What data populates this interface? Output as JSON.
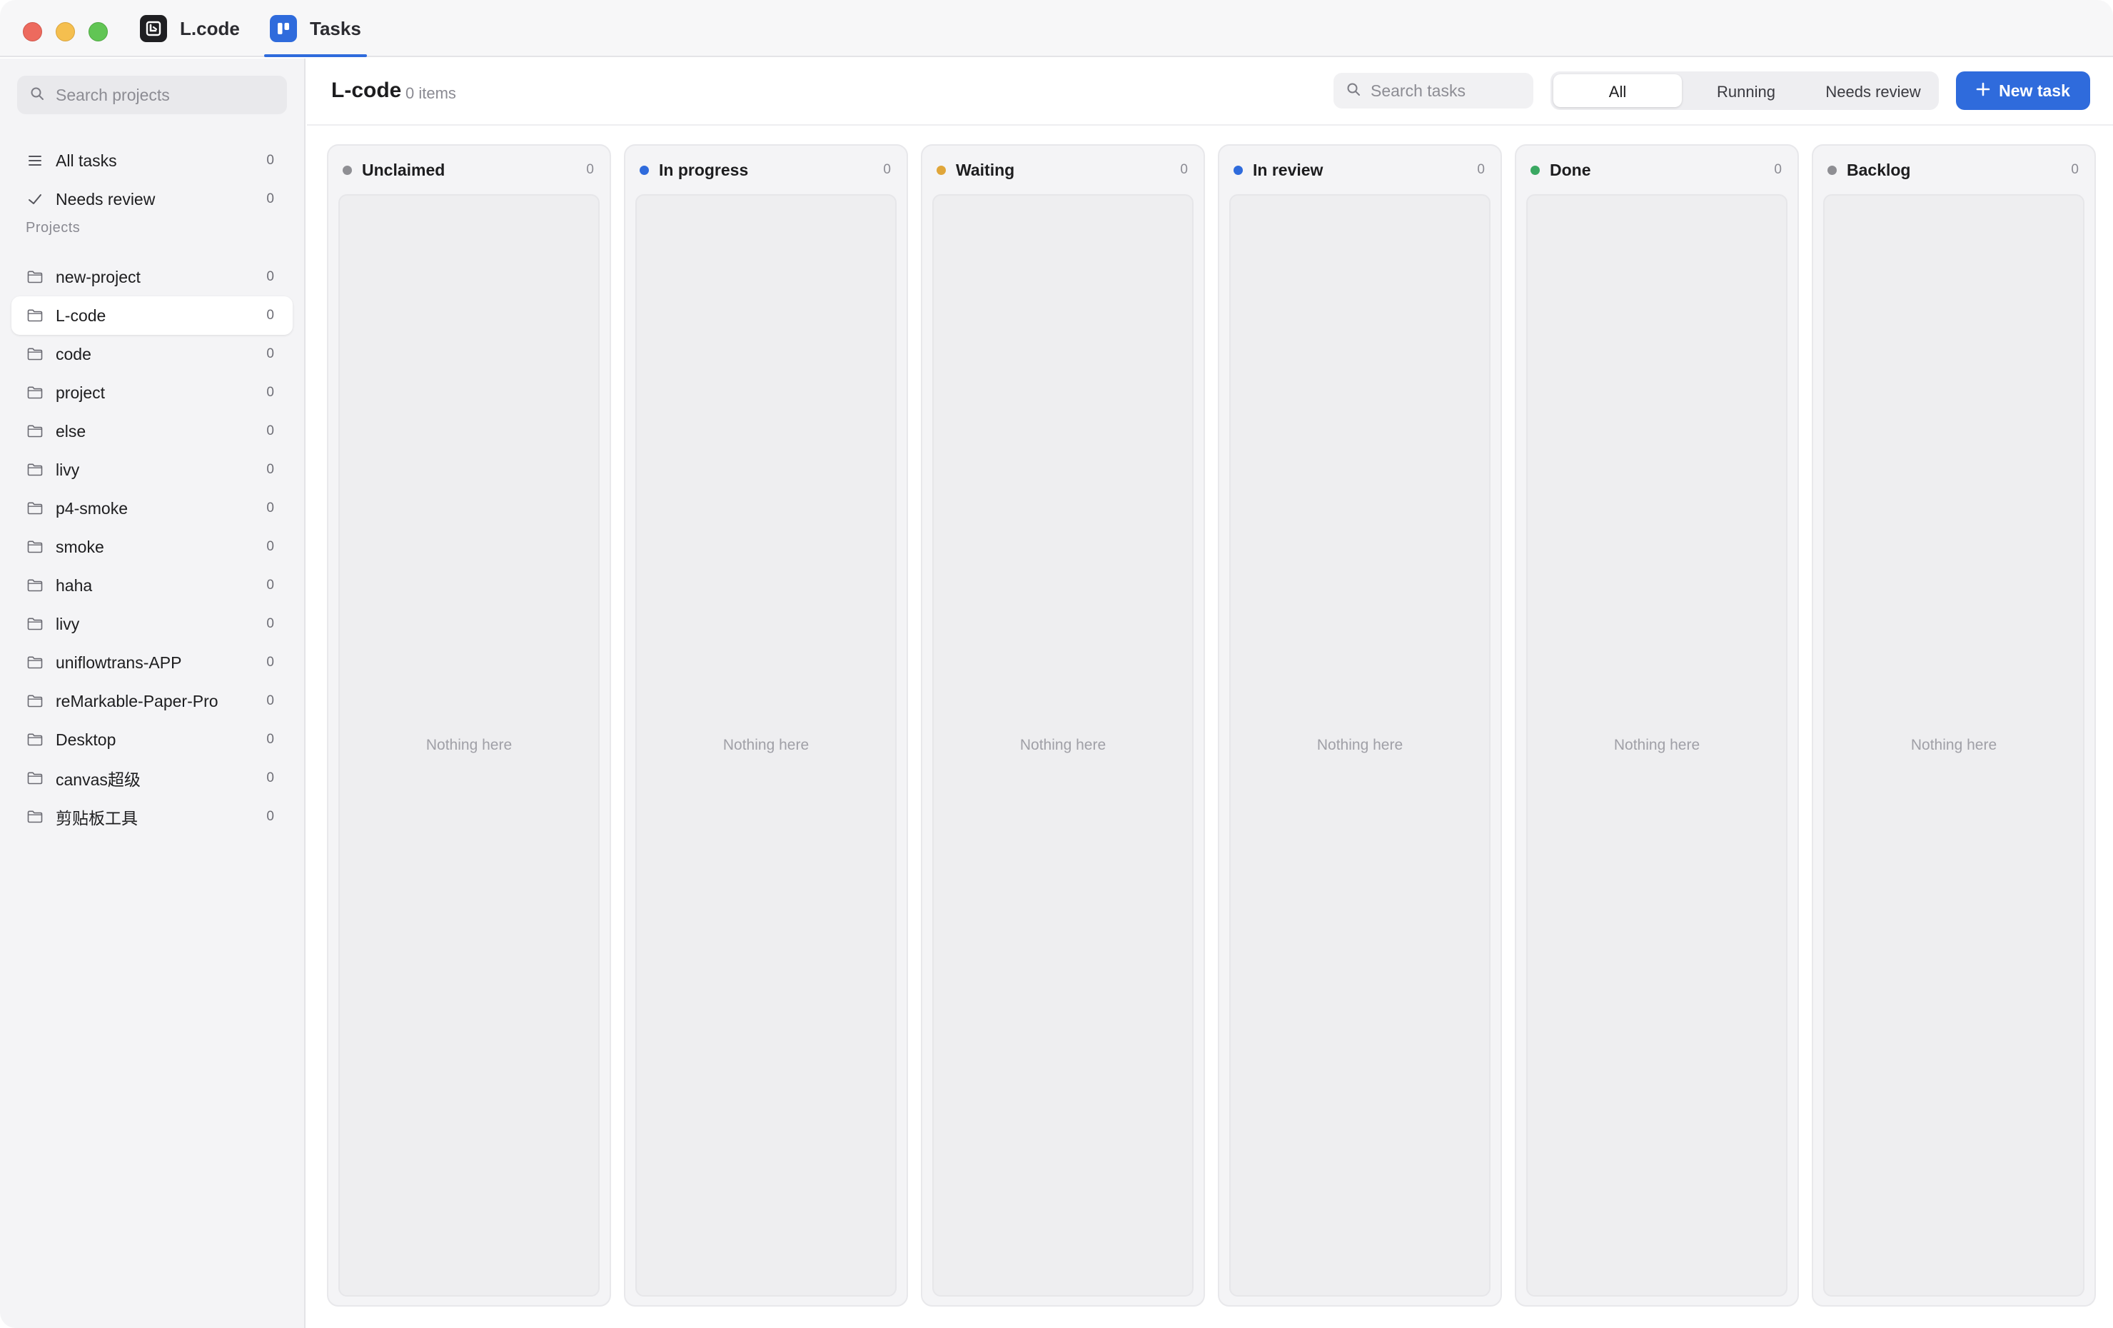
{
  "titlebar": {
    "tabs": [
      {
        "label": "L.code",
        "icon": "lcode-app-icon",
        "active": false
      },
      {
        "label": "Tasks",
        "icon": "tasks-board-icon",
        "active": true
      }
    ]
  },
  "sidebar": {
    "search_placeholder": "Search projects",
    "nav": [
      {
        "label": "All tasks",
        "icon": "list-icon",
        "count": "0"
      },
      {
        "label": "Needs review",
        "icon": "checkmark-icon",
        "count": "0"
      }
    ],
    "projects_heading": "Projects",
    "projects": [
      {
        "label": "new-project",
        "count": "0",
        "active": false
      },
      {
        "label": "L-code",
        "count": "0",
        "active": true
      },
      {
        "label": "code",
        "count": "0",
        "active": false
      },
      {
        "label": "project",
        "count": "0",
        "active": false
      },
      {
        "label": "else",
        "count": "0",
        "active": false
      },
      {
        "label": "livy",
        "count": "0",
        "active": false
      },
      {
        "label": "p4-smoke",
        "count": "0",
        "active": false
      },
      {
        "label": "smoke",
        "count": "0",
        "active": false
      },
      {
        "label": "haha",
        "count": "0",
        "active": false
      },
      {
        "label": "livy",
        "count": "0",
        "active": false
      },
      {
        "label": "uniflowtrans-APP",
        "count": "0",
        "active": false
      },
      {
        "label": "reMarkable-Paper-Pro",
        "count": "0",
        "active": false
      },
      {
        "label": "Desktop",
        "count": "0",
        "active": false
      },
      {
        "label": "canvas超级",
        "count": "0",
        "active": false
      },
      {
        "label": "剪贴板工具",
        "count": "0",
        "active": false
      }
    ]
  },
  "header": {
    "title": "L-code",
    "item_count": "0 items",
    "search_placeholder": "Search tasks",
    "filters": [
      {
        "label": "All",
        "active": true
      },
      {
        "label": "Running",
        "active": false
      },
      {
        "label": "Needs review",
        "active": false
      }
    ],
    "new_task_label": "New task"
  },
  "board": {
    "columns": [
      {
        "title": "Unclaimed",
        "count": "0",
        "dot_color": "#8e8e93",
        "empty_text": "Nothing here"
      },
      {
        "title": "In progress",
        "count": "0",
        "dot_color": "#2f6bdc",
        "empty_text": "Nothing here"
      },
      {
        "title": "Waiting",
        "count": "0",
        "dot_color": "#e0a63a",
        "empty_text": "Nothing here"
      },
      {
        "title": "In review",
        "count": "0",
        "dot_color": "#2f6bdc",
        "empty_text": "Nothing here"
      },
      {
        "title": "Done",
        "count": "0",
        "dot_color": "#3aa862",
        "empty_text": "Nothing here"
      },
      {
        "title": "Backlog",
        "count": "0",
        "dot_color": "#8e8e93",
        "empty_text": "Nothing here"
      }
    ]
  },
  "colors": {
    "accent": "#2f6bdc",
    "sidebar_bg": "#f4f4f6",
    "column_bg": "#f4f4f6"
  }
}
